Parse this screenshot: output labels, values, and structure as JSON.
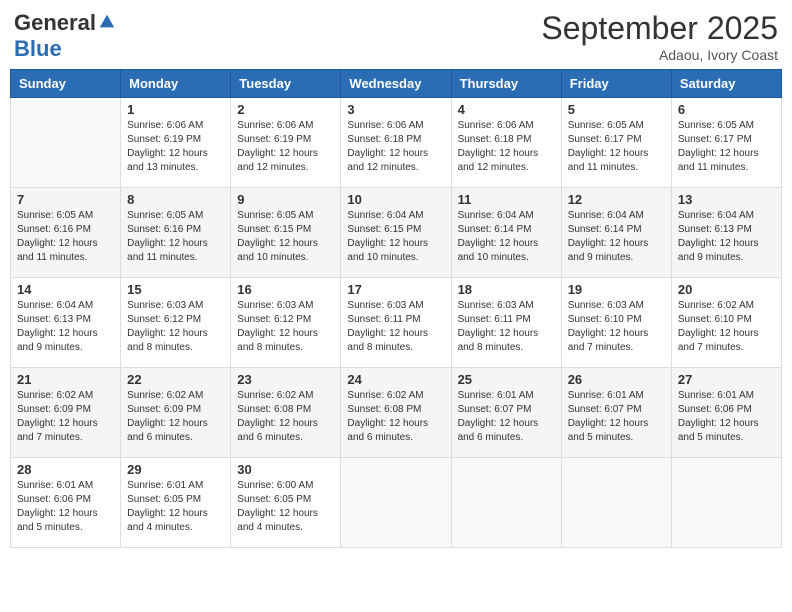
{
  "header": {
    "logo_general": "General",
    "logo_blue": "Blue",
    "month_title": "September 2025",
    "subtitle": "Adaou, Ivory Coast"
  },
  "weekdays": [
    "Sunday",
    "Monday",
    "Tuesday",
    "Wednesday",
    "Thursday",
    "Friday",
    "Saturday"
  ],
  "weeks": [
    [
      {
        "day": "",
        "sunrise": "",
        "sunset": "",
        "daylight": ""
      },
      {
        "day": "1",
        "sunrise": "Sunrise: 6:06 AM",
        "sunset": "Sunset: 6:19 PM",
        "daylight": "Daylight: 12 hours and 13 minutes."
      },
      {
        "day": "2",
        "sunrise": "Sunrise: 6:06 AM",
        "sunset": "Sunset: 6:19 PM",
        "daylight": "Daylight: 12 hours and 12 minutes."
      },
      {
        "day": "3",
        "sunrise": "Sunrise: 6:06 AM",
        "sunset": "Sunset: 6:18 PM",
        "daylight": "Daylight: 12 hours and 12 minutes."
      },
      {
        "day": "4",
        "sunrise": "Sunrise: 6:06 AM",
        "sunset": "Sunset: 6:18 PM",
        "daylight": "Daylight: 12 hours and 12 minutes."
      },
      {
        "day": "5",
        "sunrise": "Sunrise: 6:05 AM",
        "sunset": "Sunset: 6:17 PM",
        "daylight": "Daylight: 12 hours and 11 minutes."
      },
      {
        "day": "6",
        "sunrise": "Sunrise: 6:05 AM",
        "sunset": "Sunset: 6:17 PM",
        "daylight": "Daylight: 12 hours and 11 minutes."
      }
    ],
    [
      {
        "day": "7",
        "sunrise": "Sunrise: 6:05 AM",
        "sunset": "Sunset: 6:16 PM",
        "daylight": "Daylight: 12 hours and 11 minutes."
      },
      {
        "day": "8",
        "sunrise": "Sunrise: 6:05 AM",
        "sunset": "Sunset: 6:16 PM",
        "daylight": "Daylight: 12 hours and 11 minutes."
      },
      {
        "day": "9",
        "sunrise": "Sunrise: 6:05 AM",
        "sunset": "Sunset: 6:15 PM",
        "daylight": "Daylight: 12 hours and 10 minutes."
      },
      {
        "day": "10",
        "sunrise": "Sunrise: 6:04 AM",
        "sunset": "Sunset: 6:15 PM",
        "daylight": "Daylight: 12 hours and 10 minutes."
      },
      {
        "day": "11",
        "sunrise": "Sunrise: 6:04 AM",
        "sunset": "Sunset: 6:14 PM",
        "daylight": "Daylight: 12 hours and 10 minutes."
      },
      {
        "day": "12",
        "sunrise": "Sunrise: 6:04 AM",
        "sunset": "Sunset: 6:14 PM",
        "daylight": "Daylight: 12 hours and 9 minutes."
      },
      {
        "day": "13",
        "sunrise": "Sunrise: 6:04 AM",
        "sunset": "Sunset: 6:13 PM",
        "daylight": "Daylight: 12 hours and 9 minutes."
      }
    ],
    [
      {
        "day": "14",
        "sunrise": "Sunrise: 6:04 AM",
        "sunset": "Sunset: 6:13 PM",
        "daylight": "Daylight: 12 hours and 9 minutes."
      },
      {
        "day": "15",
        "sunrise": "Sunrise: 6:03 AM",
        "sunset": "Sunset: 6:12 PM",
        "daylight": "Daylight: 12 hours and 8 minutes."
      },
      {
        "day": "16",
        "sunrise": "Sunrise: 6:03 AM",
        "sunset": "Sunset: 6:12 PM",
        "daylight": "Daylight: 12 hours and 8 minutes."
      },
      {
        "day": "17",
        "sunrise": "Sunrise: 6:03 AM",
        "sunset": "Sunset: 6:11 PM",
        "daylight": "Daylight: 12 hours and 8 minutes."
      },
      {
        "day": "18",
        "sunrise": "Sunrise: 6:03 AM",
        "sunset": "Sunset: 6:11 PM",
        "daylight": "Daylight: 12 hours and 8 minutes."
      },
      {
        "day": "19",
        "sunrise": "Sunrise: 6:03 AM",
        "sunset": "Sunset: 6:10 PM",
        "daylight": "Daylight: 12 hours and 7 minutes."
      },
      {
        "day": "20",
        "sunrise": "Sunrise: 6:02 AM",
        "sunset": "Sunset: 6:10 PM",
        "daylight": "Daylight: 12 hours and 7 minutes."
      }
    ],
    [
      {
        "day": "21",
        "sunrise": "Sunrise: 6:02 AM",
        "sunset": "Sunset: 6:09 PM",
        "daylight": "Daylight: 12 hours and 7 minutes."
      },
      {
        "day": "22",
        "sunrise": "Sunrise: 6:02 AM",
        "sunset": "Sunset: 6:09 PM",
        "daylight": "Daylight: 12 hours and 6 minutes."
      },
      {
        "day": "23",
        "sunrise": "Sunrise: 6:02 AM",
        "sunset": "Sunset: 6:08 PM",
        "daylight": "Daylight: 12 hours and 6 minutes."
      },
      {
        "day": "24",
        "sunrise": "Sunrise: 6:02 AM",
        "sunset": "Sunset: 6:08 PM",
        "daylight": "Daylight: 12 hours and 6 minutes."
      },
      {
        "day": "25",
        "sunrise": "Sunrise: 6:01 AM",
        "sunset": "Sunset: 6:07 PM",
        "daylight": "Daylight: 12 hours and 6 minutes."
      },
      {
        "day": "26",
        "sunrise": "Sunrise: 6:01 AM",
        "sunset": "Sunset: 6:07 PM",
        "daylight": "Daylight: 12 hours and 5 minutes."
      },
      {
        "day": "27",
        "sunrise": "Sunrise: 6:01 AM",
        "sunset": "Sunset: 6:06 PM",
        "daylight": "Daylight: 12 hours and 5 minutes."
      }
    ],
    [
      {
        "day": "28",
        "sunrise": "Sunrise: 6:01 AM",
        "sunset": "Sunset: 6:06 PM",
        "daylight": "Daylight: 12 hours and 5 minutes."
      },
      {
        "day": "29",
        "sunrise": "Sunrise: 6:01 AM",
        "sunset": "Sunset: 6:05 PM",
        "daylight": "Daylight: 12 hours and 4 minutes."
      },
      {
        "day": "30",
        "sunrise": "Sunrise: 6:00 AM",
        "sunset": "Sunset: 6:05 PM",
        "daylight": "Daylight: 12 hours and 4 minutes."
      },
      {
        "day": "",
        "sunrise": "",
        "sunset": "",
        "daylight": ""
      },
      {
        "day": "",
        "sunrise": "",
        "sunset": "",
        "daylight": ""
      },
      {
        "day": "",
        "sunrise": "",
        "sunset": "",
        "daylight": ""
      },
      {
        "day": "",
        "sunrise": "",
        "sunset": "",
        "daylight": ""
      }
    ]
  ]
}
